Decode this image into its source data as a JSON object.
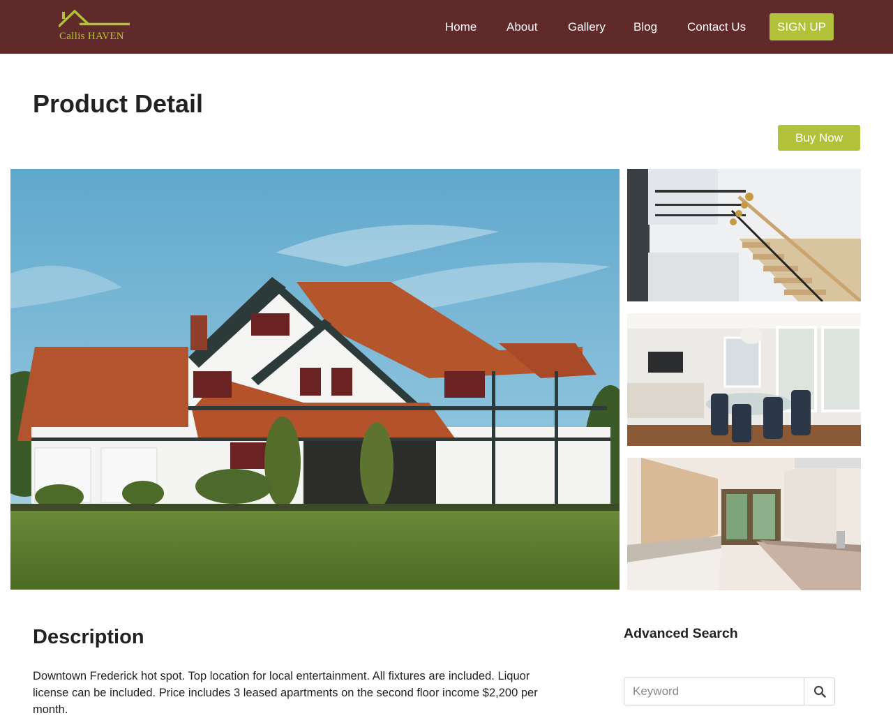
{
  "brand": {
    "logo_text_prefix": "Callis",
    "logo_text_suffix": "HAVEN",
    "accent_color": "#b1c23a",
    "header_color": "#602a2a"
  },
  "nav": {
    "items": [
      {
        "label": "Home"
      },
      {
        "label": "About"
      },
      {
        "label": "Gallery"
      },
      {
        "label": "Blog"
      },
      {
        "label": "Contact Us"
      }
    ],
    "signup_label": "SIGN UP"
  },
  "page": {
    "title": "Product Detail",
    "buy_now_label": "Buy Now"
  },
  "gallery": {
    "main_image": "house-exterior-photo",
    "thumbnails": [
      {
        "image": "staircase-interior-photo"
      },
      {
        "image": "dining-living-room-photo"
      },
      {
        "image": "kitchen-interior-photo"
      }
    ]
  },
  "description": {
    "title": "Description",
    "text": "Downtown Frederick hot spot. Top location for local entertainment. All fixtures are included. Liquor license can be included. Price includes 3 leased apartments on the second floor income $2,200 per month."
  },
  "search": {
    "title": "Advanced Search",
    "placeholder": "Keyword",
    "button_icon": "search-icon"
  }
}
